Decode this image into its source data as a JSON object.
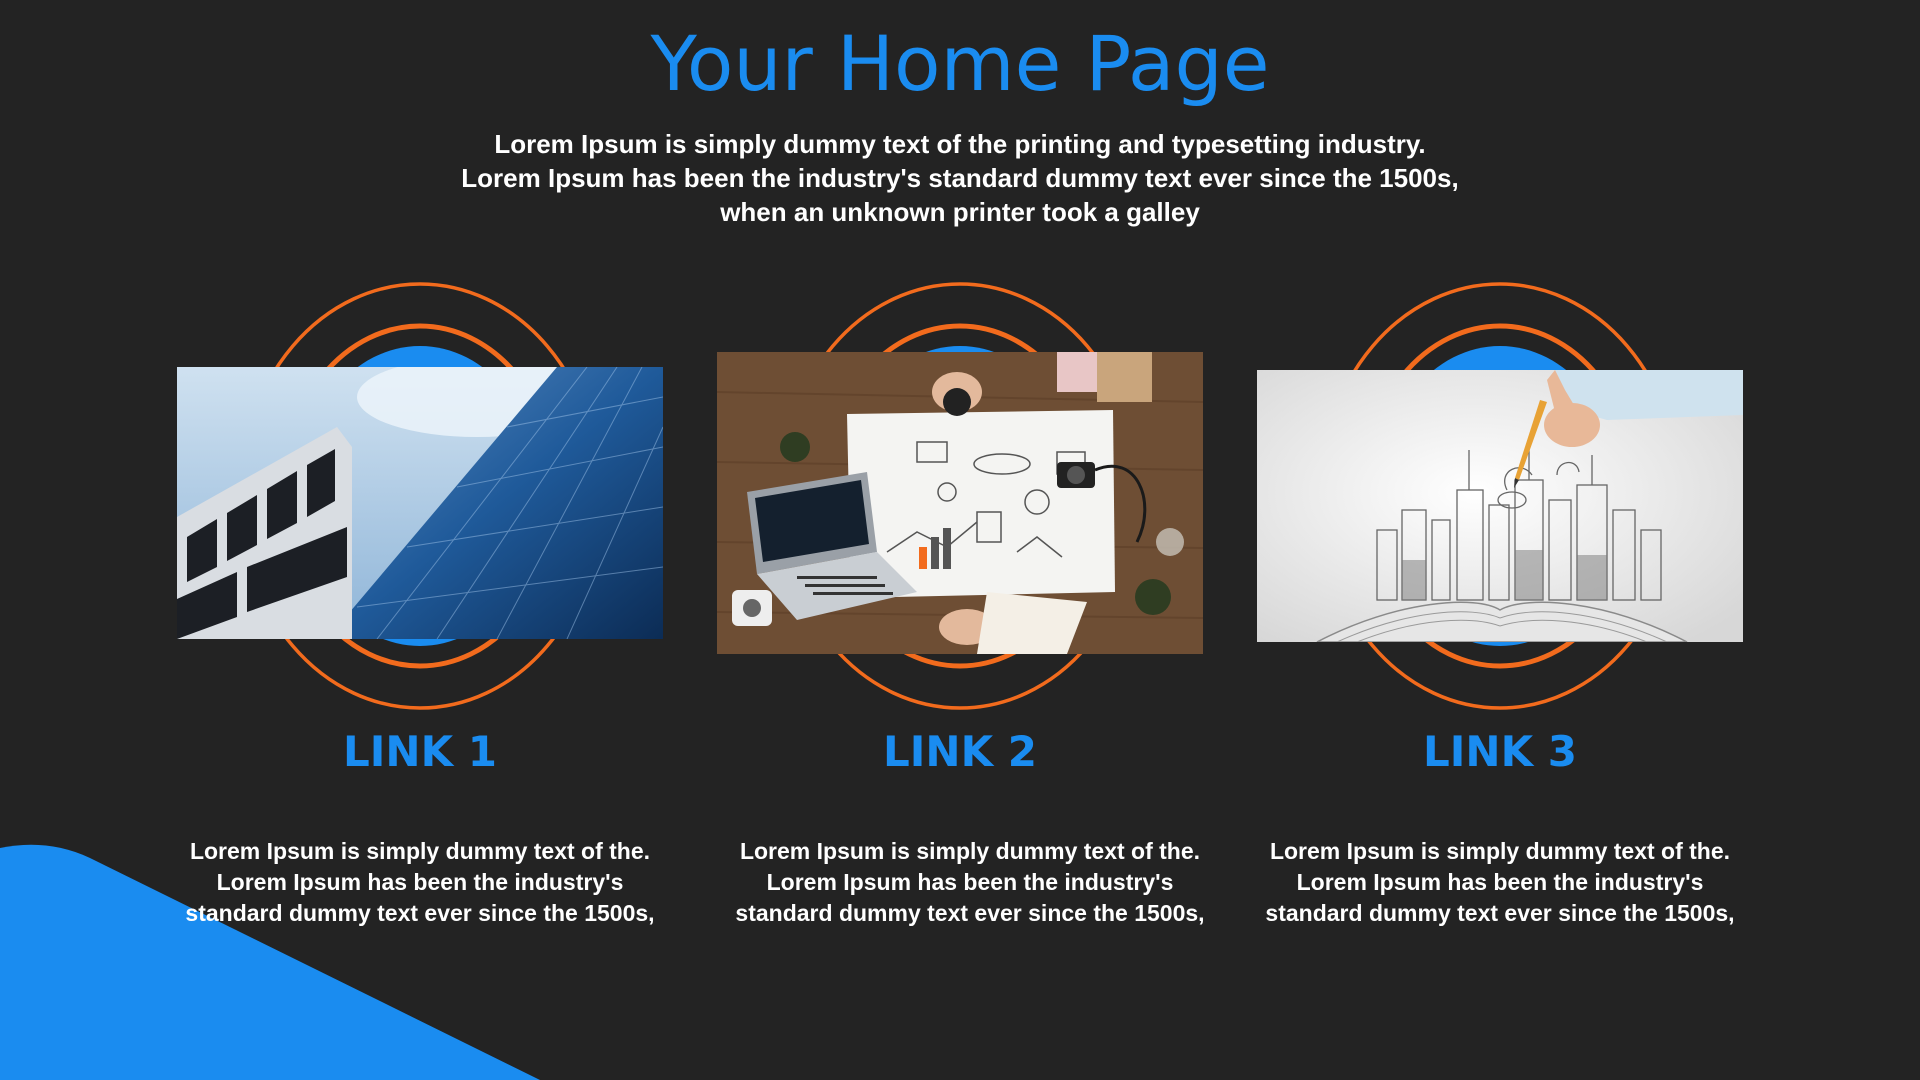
{
  "page": {
    "title": "Your Home Page",
    "intro_lines": [
      "Lorem Ipsum is simply dummy text of the printing and typesetting industry.",
      "Lorem Ipsum has been the industry's standard dummy text ever since the 1500s,",
      "when an unknown printer took a galley"
    ]
  },
  "colors": {
    "background": "#232323",
    "accent_blue": "#1a8cf0",
    "ring_orange": "#f26b1d",
    "text": "#ffffff"
  },
  "cards": [
    {
      "link_label": "LINK 1",
      "image": "glass-skyscraper-photo",
      "desc_lines": [
        "Lorem Ipsum is simply dummy text of the.",
        "Lorem Ipsum has been the industry's",
        "standard dummy text ever since the 1500s,"
      ]
    },
    {
      "link_label": "LINK 2",
      "image": "business-desk-planning-photo",
      "desc_lines": [
        "Lorem Ipsum is simply dummy text of the.",
        "Lorem Ipsum has been the industry's",
        "standard dummy text ever since the 1500s,"
      ]
    },
    {
      "link_label": "LINK 3",
      "image": "pencil-sketch-city-book-photo",
      "desc_lines": [
        "Lorem Ipsum is simply dummy text of the.",
        "Lorem Ipsum has been the industry's",
        "standard dummy text ever since the 1500s,"
      ]
    }
  ]
}
